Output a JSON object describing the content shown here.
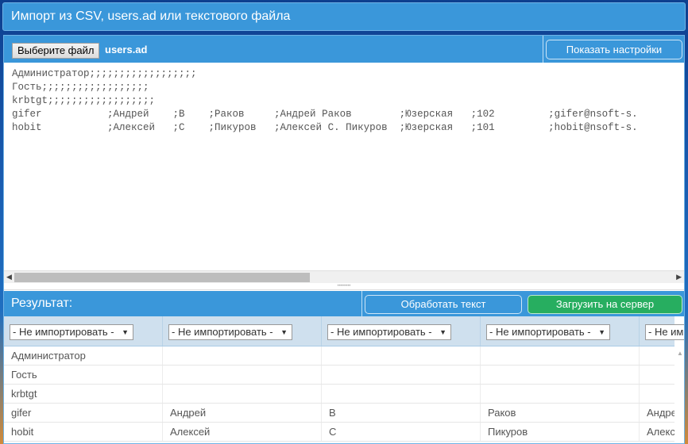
{
  "title": "Импорт из CSV, users.ad или текстового файла",
  "file": {
    "choose_label": "Выберите файл",
    "filename": "users.ad"
  },
  "show_settings_label": "Показать настройки",
  "text_lines": [
    "Администратор;;;;;;;;;;;;;;;;;;",
    "Гость;;;;;;;;;;;;;;;;;;",
    "krbtgt;;;;;;;;;;;;;;;;;;",
    "gifer           ;Андрей    ;В    ;Раков     ;Андрей Раков        ;Юзерская   ;102         ;gifer@nsoft-s.",
    "hobit           ;Алексей   ;С    ;Пикуров   ;Алексей С. Пикуров  ;Юзерская   ;101         ;hobit@nsoft-s."
  ],
  "result": {
    "label": "Результат:",
    "process_label": "Обработать текст",
    "upload_label": "Загрузить на сервер"
  },
  "colors": {
    "primary": "#3a97da",
    "success": "#27ae60"
  },
  "column_selects": [
    "- Не импортировать -",
    "- Не импортировать -",
    "- Не импортировать -",
    "- Не импортировать -",
    "- Не импортировать -"
  ],
  "rows": [
    [
      "Администратор",
      "",
      "",
      "",
      ""
    ],
    [
      "Гость",
      "",
      "",
      "",
      ""
    ],
    [
      "krbtgt",
      "",
      "",
      "",
      ""
    ],
    [
      "gifer",
      "Андрей",
      "В",
      "Раков",
      "Андрей Раков"
    ],
    [
      "hobit",
      "Алексей",
      "С",
      "Пикуров",
      "Алексей С. Пикуров"
    ]
  ]
}
